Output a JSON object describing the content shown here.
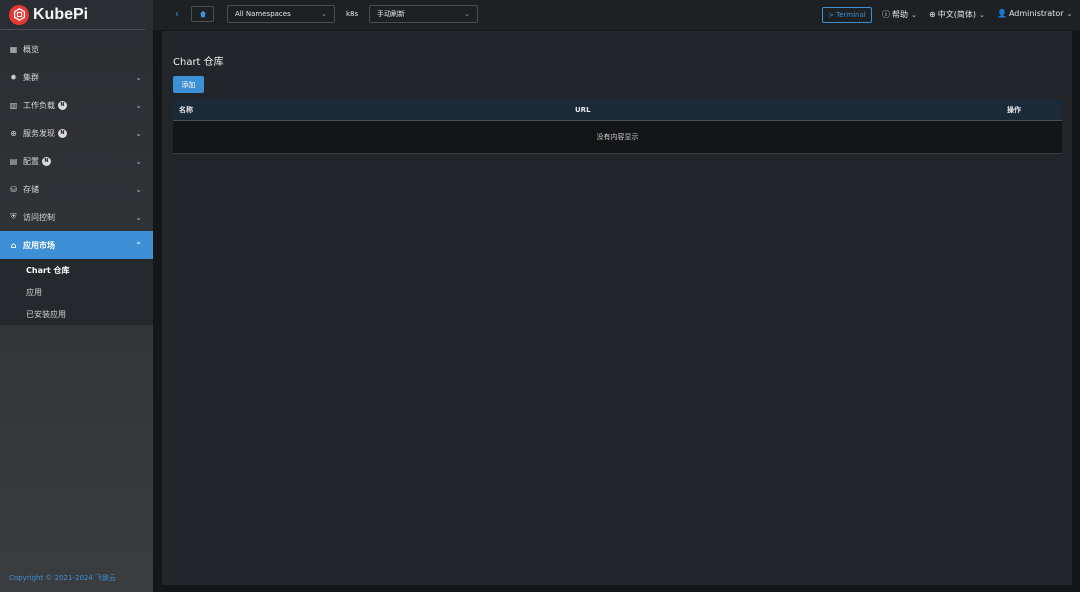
{
  "app": {
    "name": "KubePi",
    "copyright": "Copyright © 2021-2024 飞致云"
  },
  "colors": {
    "accent": "#3d8fd6",
    "logo": "#e53935"
  },
  "sidebar": {
    "items": [
      {
        "label": "概览",
        "icon": "dashboard-icon",
        "badge": "",
        "expandable": false
      },
      {
        "label": "集群",
        "icon": "cluster-icon",
        "badge": "",
        "expandable": true
      },
      {
        "label": "工作负载",
        "icon": "workload-icon",
        "badge": "N",
        "expandable": true
      },
      {
        "label": "服务发现",
        "icon": "globe-icon",
        "badge": "N",
        "expandable": true
      },
      {
        "label": "配置",
        "icon": "config-icon",
        "badge": "N",
        "expandable": true
      },
      {
        "label": "存储",
        "icon": "storage-icon",
        "badge": "",
        "expandable": true
      },
      {
        "label": "访问控制",
        "icon": "shield-icon",
        "badge": "",
        "expandable": true
      },
      {
        "label": "应用市场",
        "icon": "shop-icon",
        "badge": "",
        "expandable": true,
        "active": true
      }
    ],
    "submenu": [
      {
        "label": "Chart 仓库",
        "active": true
      },
      {
        "label": "应用"
      },
      {
        "label": "已安装应用"
      }
    ]
  },
  "header": {
    "namespace": "All Namespaces",
    "cluster": "k8s",
    "refresh": "手动刷新",
    "terminal": "Terminal",
    "help": "帮助",
    "language": "中文(简体)",
    "user": "Administrator"
  },
  "main": {
    "title": "Chart 仓库",
    "add_label": "添加",
    "columns": [
      "名称",
      "URL",
      "操作"
    ],
    "empty_text": "没有内容显示"
  }
}
